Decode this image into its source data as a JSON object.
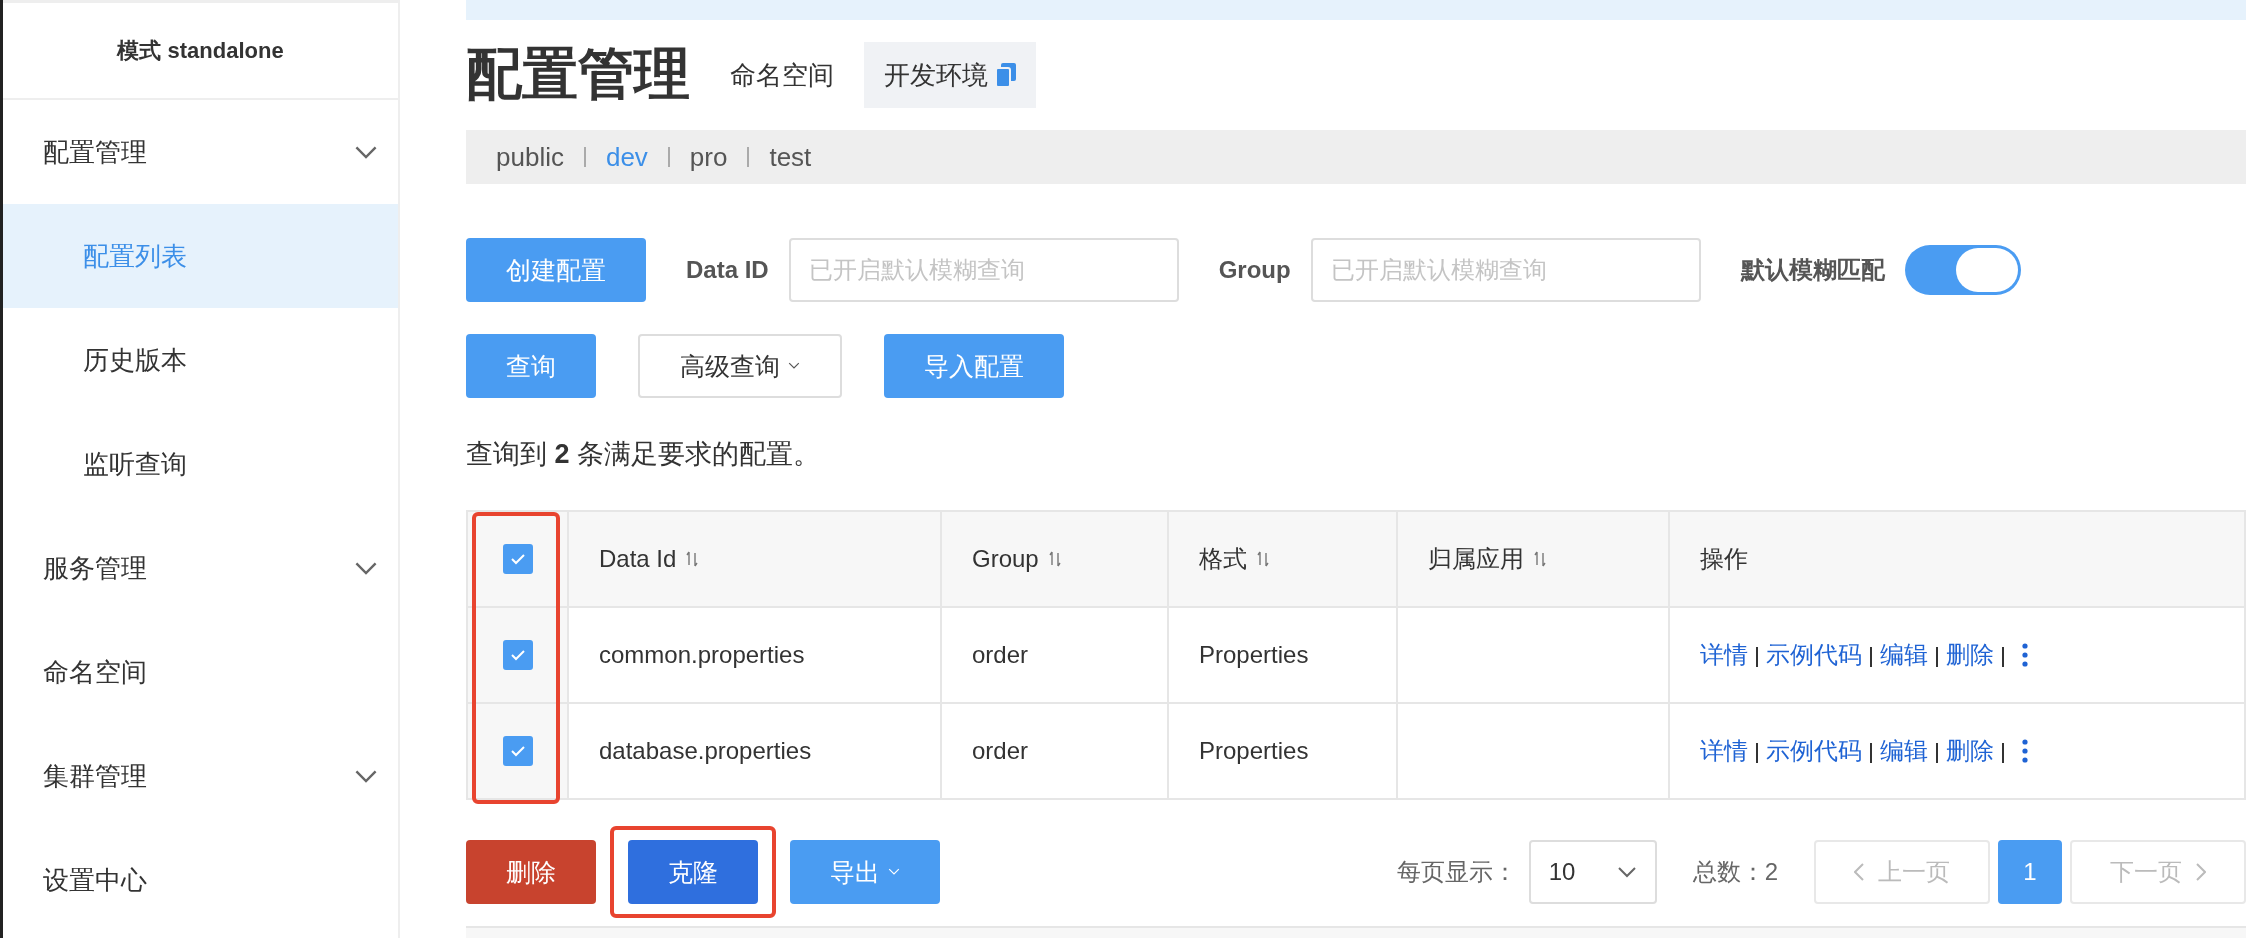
{
  "sidebar": {
    "mode_label": "模式 standalone",
    "items": [
      {
        "label": "配置管理",
        "kind": "group",
        "children": [
          {
            "label": "配置列表",
            "selected": true
          },
          {
            "label": "历史版本",
            "selected": false
          },
          {
            "label": "监听查询",
            "selected": false
          }
        ]
      },
      {
        "label": "服务管理",
        "kind": "group"
      },
      {
        "label": "命名空间",
        "kind": "link"
      },
      {
        "label": "集群管理",
        "kind": "group"
      },
      {
        "label": "设置中心",
        "kind": "link"
      }
    ]
  },
  "header": {
    "title": "配置管理",
    "namespace_label": "命名空间",
    "namespace_value": "开发环境"
  },
  "namespace_tabs": [
    {
      "label": "public",
      "selected": false
    },
    {
      "label": "dev",
      "selected": true
    },
    {
      "label": "pro",
      "selected": false
    },
    {
      "label": "test",
      "selected": false
    }
  ],
  "filters": {
    "create_button": "创建配置",
    "fields": [
      {
        "label": "Data ID",
        "placeholder": "已开启默认模糊查询"
      },
      {
        "label": "Group",
        "placeholder": "已开启默认模糊查询"
      }
    ],
    "toggle": {
      "label": "默认模糊匹配",
      "on": true
    }
  },
  "query_buttons": [
    {
      "label": "查询",
      "kind": "primary"
    },
    {
      "label": "高级查询",
      "kind": "dropdown"
    },
    {
      "label": "导入配置",
      "kind": "primary"
    }
  ],
  "result_text": "查询到 **2** 条满足要求的配置。",
  "table": {
    "select_all_checked": true,
    "checkbox_column_highlighted": true,
    "columns": [
      {
        "label": "Data Id",
        "sortable": true
      },
      {
        "label": "Group",
        "sortable": true
      },
      {
        "label": "格式",
        "sortable": true
      },
      {
        "label": "归属应用",
        "sortable": true
      },
      {
        "label": "操作",
        "sortable": false
      }
    ],
    "rows": [
      {
        "checked": true,
        "cells": [
          "common.properties",
          "order",
          "Properties",
          ""
        ],
        "actions": [
          "详情",
          "示例代码",
          "编辑",
          "删除"
        ]
      },
      {
        "checked": true,
        "cells": [
          "database.properties",
          "order",
          "Properties",
          ""
        ],
        "actions": [
          "详情",
          "示例代码",
          "编辑",
          "删除"
        ]
      }
    ]
  },
  "bulk_actions": [
    {
      "label": "删除",
      "kind": "danger",
      "highlighted": false
    },
    {
      "label": "克隆",
      "kind": "primary",
      "highlighted": true
    },
    {
      "label": "导出",
      "kind": "dropdown",
      "highlighted": false
    }
  ],
  "pagination": {
    "page_size_label": "每页显示：",
    "page_size": "10",
    "total": "总数：2",
    "prev": {
      "label": "上一页",
      "disabled": true
    },
    "pages": [
      {
        "label": "1",
        "selected": true
      }
    ],
    "next": {
      "label": "下一页",
      "disabled": true
    }
  }
}
